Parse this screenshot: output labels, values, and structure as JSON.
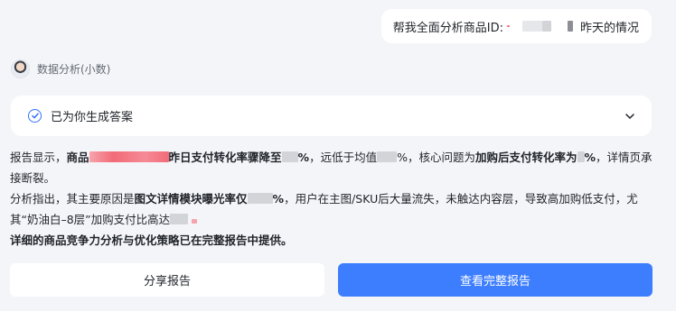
{
  "user_message": {
    "prefix": "帮我全面分析商品ID:",
    "suffix": "昨天的情况"
  },
  "assistant": {
    "name": "数据分析(小数)"
  },
  "answer_card": {
    "title": "已为你生成答案"
  },
  "report": {
    "p1_a": "报告显示，",
    "p1_b": "商品",
    "p1_c": "昨日支付转化率骤降至",
    "p1_d": "%",
    "p1_e": "，远低于均值",
    "p1_f": "%，核心问题为",
    "p1_g": "加购后支付转化率为",
    "p1_h": "%",
    "p1_i": "，详情页承接断裂。",
    "p2_a": "分析指出，其主要原因是",
    "p2_b": "图文详情模块曝光率仅",
    "p2_c": "%",
    "p2_d": "，用户在主图/SKU后大量流失，未触达内容层，导致高加购低支付，尤其“奶油白–8层”加购支付比高达",
    "p3": "详细的商品竞争力分析与优化策略已在完整报告中提供。"
  },
  "buttons": {
    "share": "分享报告",
    "full_report": "查看完整报告"
  },
  "colors": {
    "accent": "#3d7efe",
    "background": "#f4f5f8",
    "redaction_pink": "#f26b78"
  }
}
